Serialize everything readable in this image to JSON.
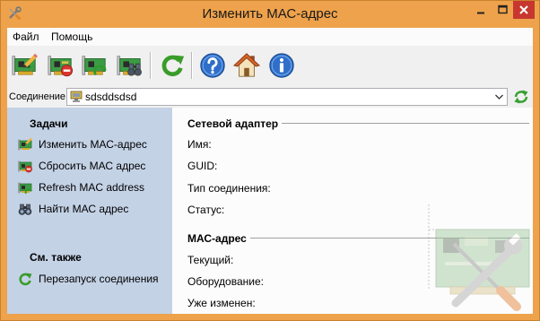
{
  "window": {
    "title": "Изменить МАС-адрес",
    "icon": "tools-icon",
    "buttons": {
      "minimize": "minimize-icon",
      "maximize": "maximize-icon",
      "close": "close-icon"
    }
  },
  "colors": {
    "frame": "#eea24b",
    "side_panel": "#c4d2e6",
    "close_button": "#c7372f"
  },
  "menu": {
    "items": [
      {
        "label": "Файл"
      },
      {
        "label": "Помощь"
      }
    ]
  },
  "toolbar": {
    "buttons": [
      {
        "icon": "change-mac-icon"
      },
      {
        "icon": "reset-mac-icon"
      },
      {
        "icon": "refresh-mac-icon"
      },
      {
        "icon": "find-mac-icon"
      },
      {
        "icon": "restart-connection-icon"
      },
      {
        "icon": "help-icon"
      },
      {
        "icon": "home-icon"
      },
      {
        "icon": "info-icon"
      }
    ]
  },
  "connection": {
    "label": "Соединение",
    "value": "sdsddsdsd",
    "icon": "network-adapter-icon",
    "refresh_icon": "refresh-icon"
  },
  "tasks": {
    "title": "Задачи",
    "items": [
      {
        "label": "Изменить МАС-адрес",
        "icon": "change-mac-icon"
      },
      {
        "label": "Сбросить МАС адрес",
        "icon": "reset-mac-icon"
      },
      {
        "label": "Refresh MAC address",
        "icon": "refresh-mac-icon"
      },
      {
        "label": "Найти МАС адрес",
        "icon": "binoculars-icon"
      }
    ]
  },
  "see_also": {
    "title": "См. также",
    "items": [
      {
        "label": "Перезапуск соединения",
        "icon": "restart-connection-icon"
      }
    ]
  },
  "adapter": {
    "title": "Сетевой адаптер",
    "fields": [
      {
        "label": "Имя:"
      },
      {
        "label": "GUID:"
      },
      {
        "label": "Тип соединения:"
      },
      {
        "label": "Статус:"
      }
    ]
  },
  "mac": {
    "title": "МАС-адрес",
    "fields": [
      {
        "label": "Текущий:"
      },
      {
        "label": "Оборудование:"
      },
      {
        "label": "Уже изменен:"
      }
    ]
  }
}
